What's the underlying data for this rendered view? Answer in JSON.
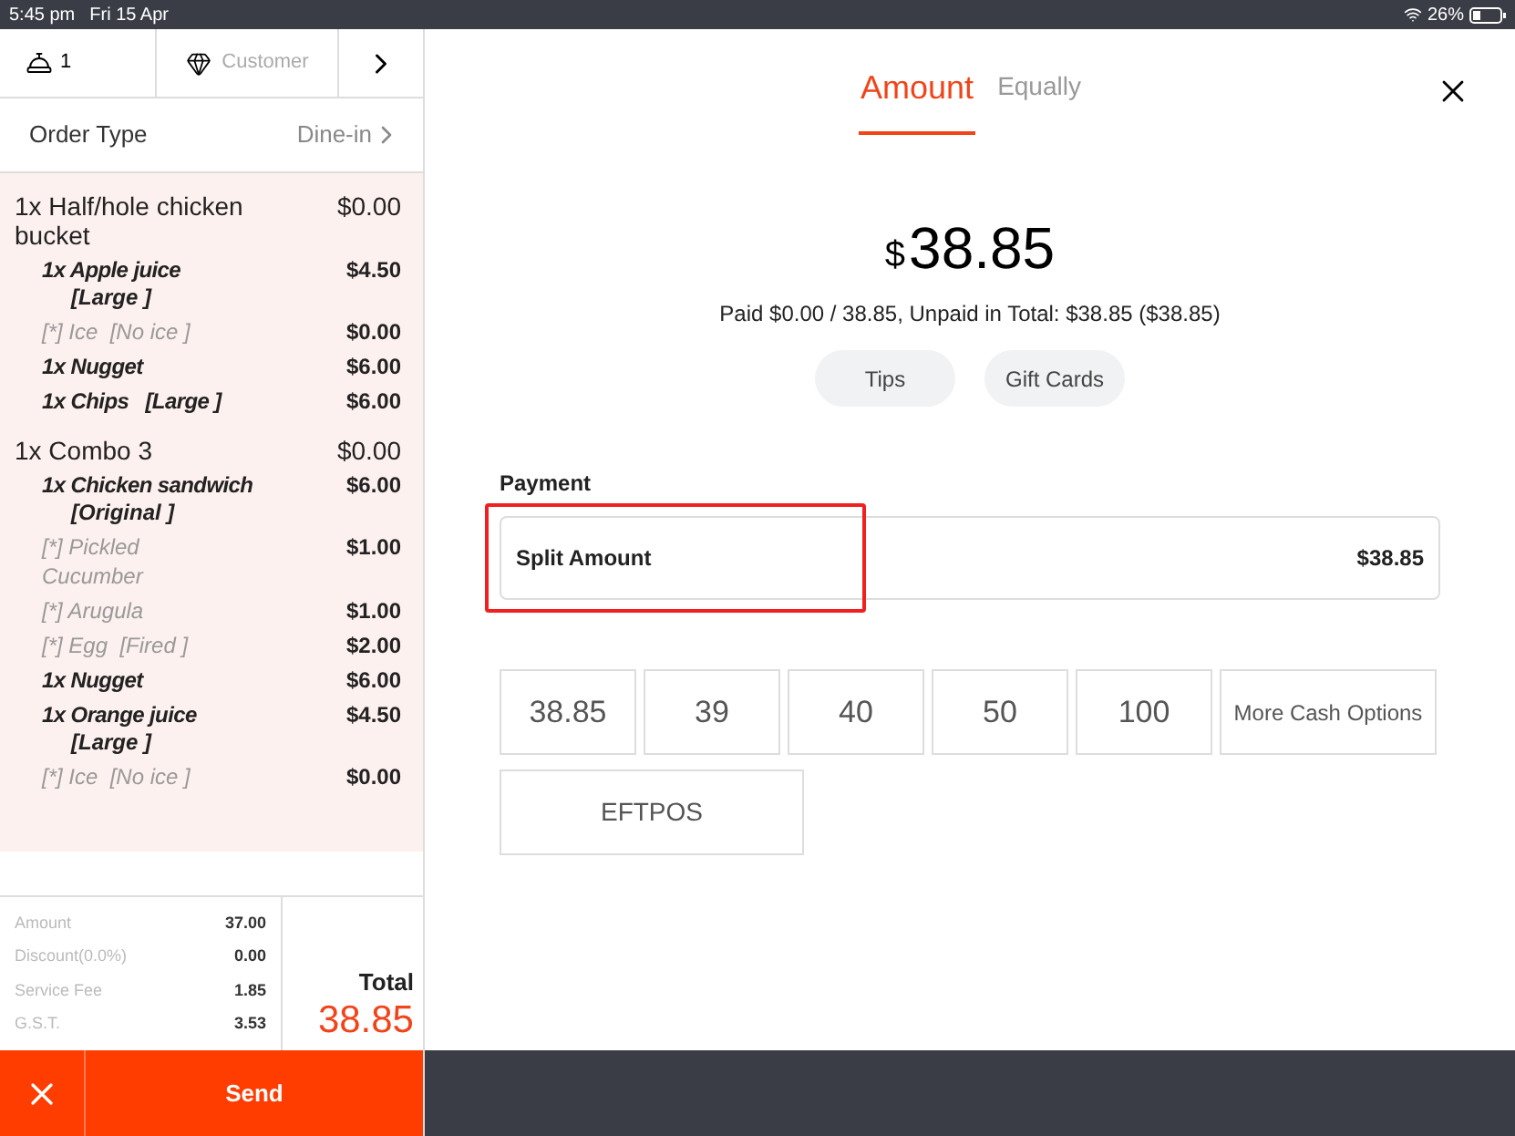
{
  "status_bar": {
    "time": "5:45 pm",
    "date": "Fri 15 Apr",
    "battery": "26%"
  },
  "order_header": {
    "guests": "1",
    "customer_placeholder": "Customer",
    "order_type_label": "Order Type",
    "order_type_value": "Dine-in"
  },
  "order_items": [
    {
      "kind": "main",
      "name": "1x Half/hole chicken bucket",
      "price": "$0.00"
    },
    {
      "kind": "sub",
      "name": "1x Apple juice",
      "option": "[Large ]",
      "price": "$4.50"
    },
    {
      "kind": "modifier",
      "name": "[*] Ice  [No ice ]",
      "price": "$0.00"
    },
    {
      "kind": "sub",
      "name": "1x Nugget",
      "price": "$6.00"
    },
    {
      "kind": "sub",
      "name": "1x Chips   [Large ]",
      "price": "$6.00"
    },
    {
      "kind": "main",
      "name": "1x Combo 3",
      "price": "$0.00"
    },
    {
      "kind": "sub",
      "name": "1x Chicken sandwich",
      "option": "[Original ]",
      "price": "$6.00"
    },
    {
      "kind": "modifier",
      "name": "[*] Pickled Cucumber",
      "price": "$1.00"
    },
    {
      "kind": "modifier",
      "name": "[*] Arugula",
      "price": "$1.00"
    },
    {
      "kind": "modifier",
      "name": "[*] Egg  [Fired ]",
      "price": "$2.00"
    },
    {
      "kind": "sub",
      "name": "1x Nugget",
      "price": "$6.00"
    },
    {
      "kind": "sub",
      "name": "1x Orange juice",
      "option": "[Large ]",
      "price": "$4.50"
    },
    {
      "kind": "modifier",
      "name": "[*] Ice  [No ice ]",
      "price": "$0.00"
    }
  ],
  "summary": [
    {
      "label": "Amount",
      "value": "37.00"
    },
    {
      "label": "Discount(0.0%)",
      "value": "0.00"
    },
    {
      "label": "Service Fee",
      "value": "1.85"
    },
    {
      "label": "G.S.T.",
      "value": "3.53"
    }
  ],
  "total": {
    "label": "Total",
    "value": "38.85"
  },
  "send_button": "Send",
  "tabs": [
    {
      "label": "Amount",
      "selected": true
    },
    {
      "label": "Equally",
      "selected": false
    }
  ],
  "amount": {
    "currency": "$",
    "value": "38.85",
    "status": "Paid $0.00 / 38.85, Unpaid in Total: $38.85 ($38.85)"
  },
  "extras": [
    "Tips",
    "Gift Cards"
  ],
  "payment": {
    "label": "Payment",
    "name": "Split Amount",
    "value": "$38.85",
    "highlighted": true
  },
  "cash_options": [
    "38.85",
    "39",
    "40",
    "50",
    "100",
    "More Cash Options"
  ],
  "other_methods": [
    "EFTPOS"
  ]
}
